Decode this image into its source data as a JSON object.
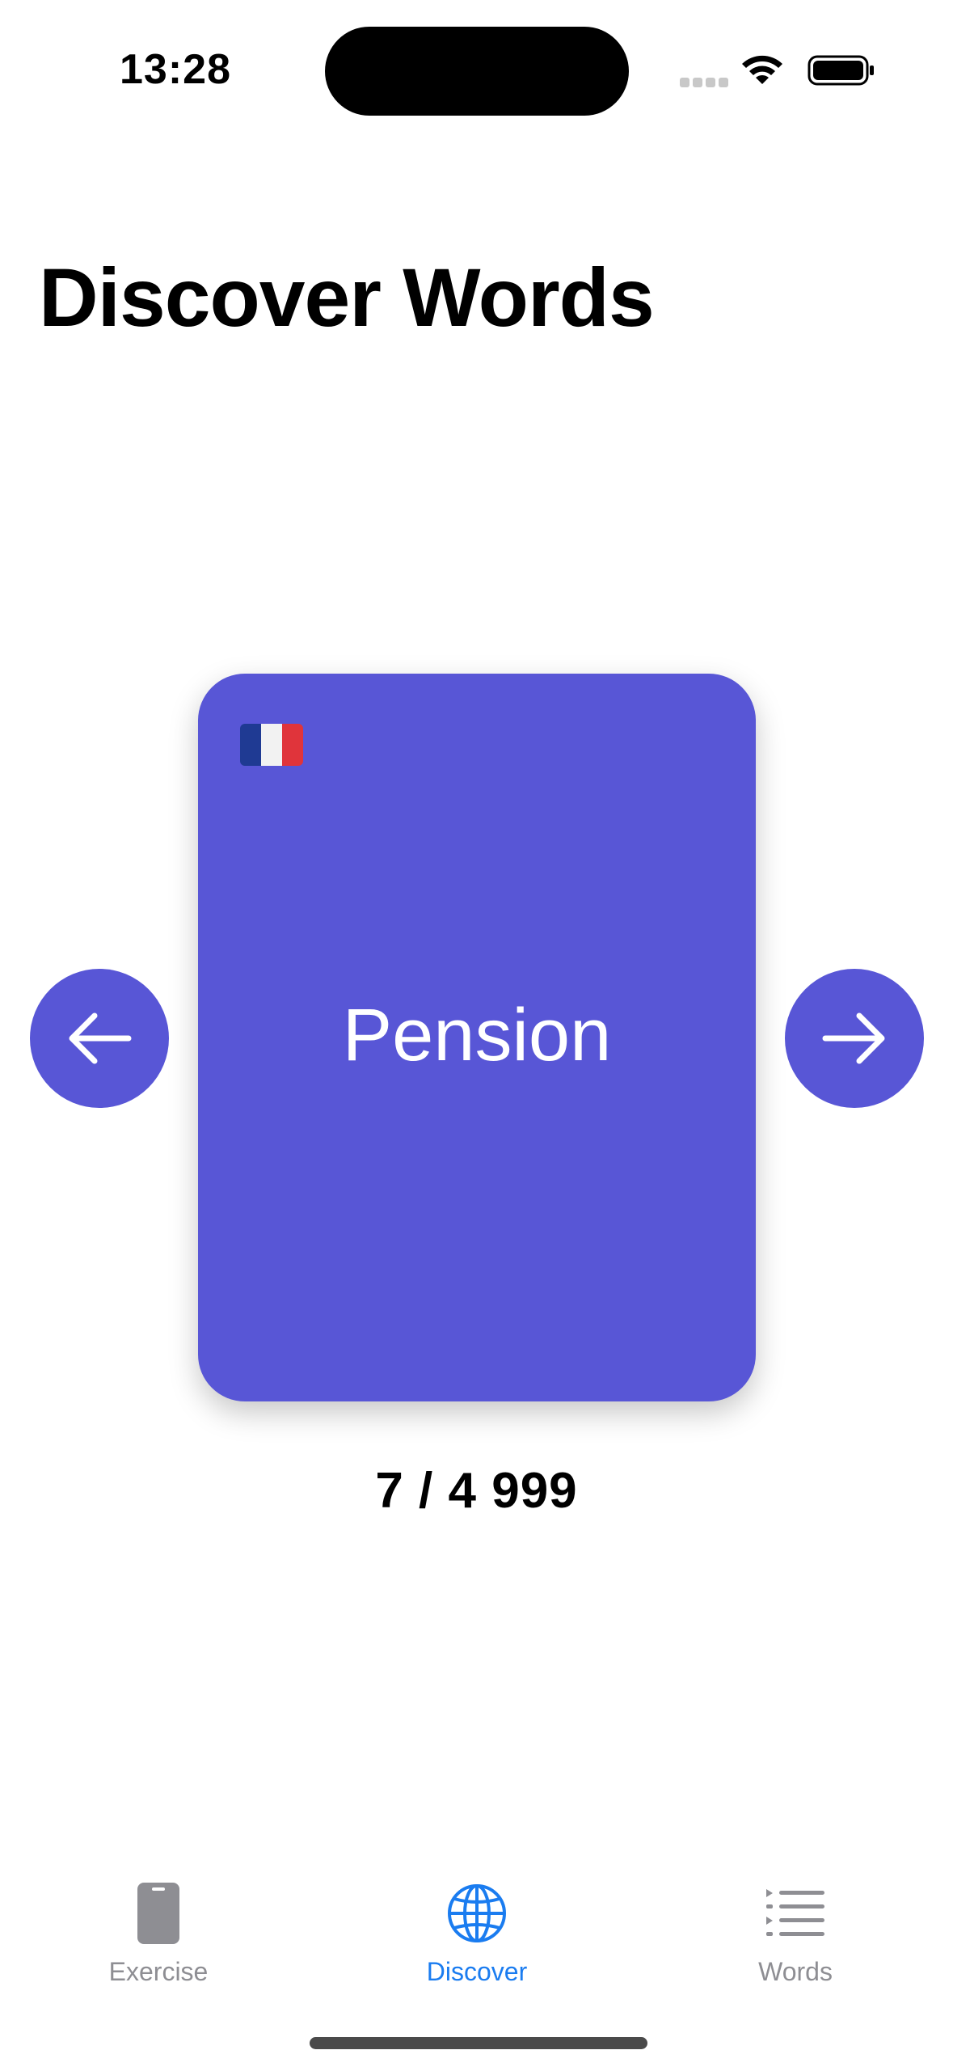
{
  "status_bar": {
    "time": "13:28"
  },
  "header": {
    "title": "Discover Words"
  },
  "card": {
    "flag": "france-flag-icon",
    "word": "Pension",
    "color": "#5856d6"
  },
  "navigation": {
    "prev_icon": "arrow-left-icon",
    "next_icon": "arrow-right-icon"
  },
  "counter": {
    "text": "7 / 4 999"
  },
  "tab_bar": {
    "active_color": "#1a7cf0",
    "inactive_color": "#8e8e93",
    "items": [
      {
        "label": "Exercise",
        "icon": "phone-card-icon",
        "active": false
      },
      {
        "label": "Discover",
        "icon": "globe-icon",
        "active": true
      },
      {
        "label": "Words",
        "icon": "list-icon",
        "active": false
      }
    ]
  }
}
